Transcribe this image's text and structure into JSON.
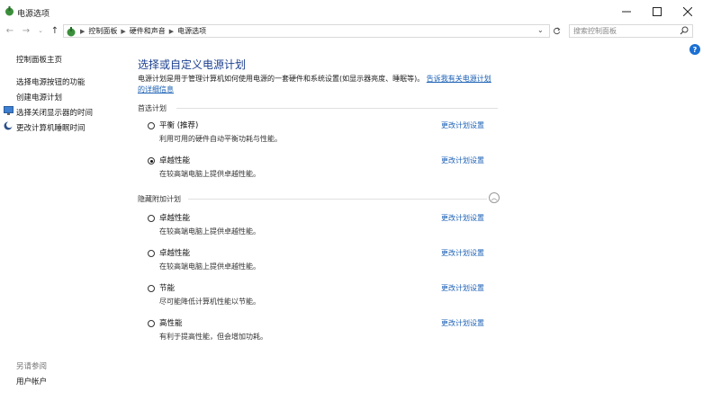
{
  "window": {
    "title": "电源选项"
  },
  "address": {
    "crumbs": [
      "控制面板",
      "硬件和声音",
      "电源选项"
    ],
    "search_placeholder": "搜索控制面板"
  },
  "sidebar": {
    "home": "控制面板主页",
    "items": [
      "选择电源按钮的功能",
      "创建电源计划",
      "选择关闭显示器的时间",
      "更改计算机睡眠时间"
    ],
    "see_also": "另请参阅",
    "user_accounts": "用户帐户"
  },
  "main": {
    "heading": "选择或自定义电源计划",
    "desc": "电源计划是用于管理计算机如何使用电源的一套硬件和系统设置(如显示器亮度、睡眠等)。",
    "desc_link": "告诉我有关电源计划的详细信息",
    "preferred_label": "首选计划",
    "hidden_label": "隐藏附加计划",
    "preferred_plans": [
      {
        "name": "平衡 (推荐)",
        "desc": "利用可用的硬件自动平衡功耗与性能。",
        "change": "更改计划设置",
        "selected": false
      },
      {
        "name": "卓越性能",
        "desc": "在较高端电脑上提供卓越性能。",
        "change": "更改计划设置",
        "selected": true
      }
    ],
    "hidden_plans": [
      {
        "name": "卓越性能",
        "desc": "在较高端电脑上提供卓越性能。",
        "change": "更改计划设置"
      },
      {
        "name": "卓越性能",
        "desc": "在较高端电脑上提供卓越性能。",
        "change": "更改计划设置"
      },
      {
        "name": "节能",
        "desc": "尽可能降低计算机性能以节能。",
        "change": "更改计划设置"
      },
      {
        "name": "高性能",
        "desc": "有利于提高性能，但会增加功耗。",
        "change": "更改计划设置"
      }
    ]
  },
  "icons": {
    "app": "power-options-icon",
    "back": "arrow-left-icon",
    "forward": "arrow-right-icon",
    "up": "arrow-up-icon",
    "refresh": "refresh-icon",
    "search": "search-icon",
    "help": "help-icon"
  },
  "help_glyph": "?"
}
